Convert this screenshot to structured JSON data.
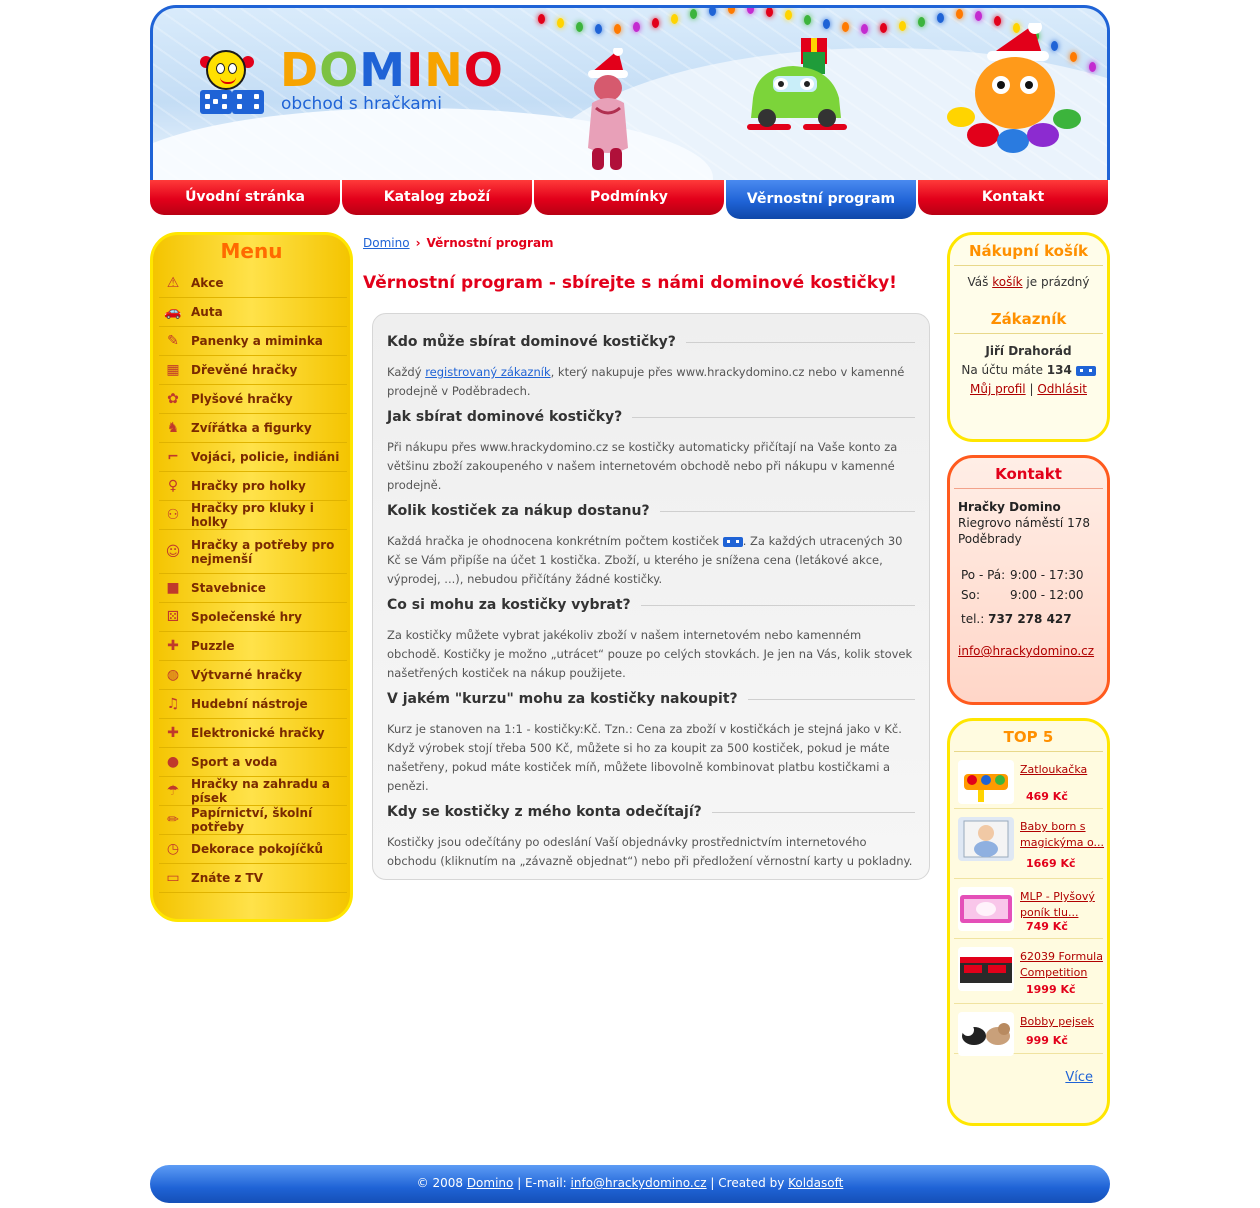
{
  "header": {
    "brand_letters": [
      "D",
      "O",
      "M",
      "I",
      "N",
      "O"
    ],
    "tagline": "obchod s hračkami"
  },
  "nav": {
    "items": [
      "Úvodní stránka",
      "Katalog zboží",
      "Podmínky",
      "Věrnostní program",
      "Kontakt"
    ],
    "active": "Věrnostní program"
  },
  "menu": {
    "title": "Menu",
    "items": [
      {
        "label": "Akce",
        "icon": "warning-icon"
      },
      {
        "label": "Auta",
        "icon": "car-icon"
      },
      {
        "label": "Panenky a miminka",
        "icon": "rattle-icon"
      },
      {
        "label": "Dřevěné hračky",
        "icon": "train-icon"
      },
      {
        "label": "Plyšové hračky",
        "icon": "plush-icon"
      },
      {
        "label": "Zvířátka a figurky",
        "icon": "elephant-icon"
      },
      {
        "label": "Vojáci, policie, indiáni",
        "icon": "gun-icon"
      },
      {
        "label": "Hračky pro holky",
        "icon": "girl-icon"
      },
      {
        "label": "Hračky pro kluky i holky",
        "icon": "kids-icon"
      },
      {
        "label": "Hračky a potřeby pro nejmenší",
        "icon": "baby-icon"
      },
      {
        "label": "Stavebnice",
        "icon": "blocks-icon"
      },
      {
        "label": "Společenské hry",
        "icon": "dice-icon"
      },
      {
        "label": "Puzzle",
        "icon": "puzzle-icon"
      },
      {
        "label": "Výtvarné hračky",
        "icon": "palette-icon"
      },
      {
        "label": "Hudební nástroje",
        "icon": "music-icon"
      },
      {
        "label": "Elektronické hračky",
        "icon": "plus-icon"
      },
      {
        "label": "Sport a voda",
        "icon": "ball-icon"
      },
      {
        "label": "Hračky na zahradu a písek",
        "icon": "bucket-icon"
      },
      {
        "label": "Papírnictví, školní potřeby",
        "icon": "pencil-icon"
      },
      {
        "label": "Dekorace pokojíčků",
        "icon": "clock-icon"
      },
      {
        "label": "Znáte z TV",
        "icon": "tv-icon"
      }
    ]
  },
  "breadcrumb": {
    "home": "Domino",
    "separator": "›",
    "current": "Věrnostní program"
  },
  "page_title": "Věrnostní program - sbírejte s námi dominové kostičky!",
  "sections": [
    {
      "heading": "Kdo může sbírat dominové kostičky?",
      "parts": [
        "Každý ",
        "registrovaný zákazník",
        ", který nakupuje přes www.hrackydomino.cz nebo v kamenné prodejně v Poděbradech."
      ]
    },
    {
      "heading": "Jak sbírat dominové kostičky?",
      "text": "Při nákupu přes www.hrackydomino.cz se kostičky automaticky přičítají na Vaše konto za většinu zboží zakoupeného v našem internetovém obchodě nebo při nákupu v kamenné prodejně."
    },
    {
      "heading": "Kolik kostiček za nákup dostanu?",
      "before_icon": "Každá hračka je ohodnocena konkrétním počtem kostiček ",
      "after_icon": ". Za každých utracených 30 Kč se Vám připíše na účet 1 kostička. Zboží, u kterého je snížena cena (letákové akce, výprodej, ...), nebudou přičítány žádné kostičky."
    },
    {
      "heading": "Co si mohu za kostičky vybrat?",
      "text": "Za kostičky můžete vybrat jakékoliv zboží v našem internetovém nebo kamenném obchodě. Kostičky je možno „utrácet“ pouze po celých stovkách. Je jen na Vás, kolik stovek našetřených kostiček na nákup použijete."
    },
    {
      "heading": "V jakém \"kurzu\" mohu za kostičky nakoupit?",
      "text": "Kurz je stanoven na 1:1 - kostičky:Kč. Tzn.: Cena za zboží v kostičkách je stejná jako v Kč. Když výrobek stojí třeba 500 Kč, můžete si ho za koupit za 500 kostiček, pokud je máte našetřeny, pokud máte kostiček míň, můžete libovolně kombinovat platbu kostičkami a penězi."
    },
    {
      "heading": "Kdy se kostičky z mého konta odečítají?",
      "text": "Kostičky jsou odečítány po odeslání Vaší objednávky prostřednictvím internetového obchodu (kliknutím na „závazně objednat“) nebo při předložení věrnostní karty u pokladny."
    }
  ],
  "cart": {
    "title": "Nákupní košík",
    "text_before": "Váš ",
    "link": "košík",
    "text_after": " je prázdný"
  },
  "customer": {
    "title": "Zákazník",
    "name": "Jiří Drahorád",
    "account_prefix": "Na účtu máte ",
    "points": "134",
    "profile_link": "Můj profil",
    "divider": "|",
    "logout_link": "Odhlásit"
  },
  "contact": {
    "title": "Kontakt",
    "company": "Hračky Domino",
    "street": "Riegrovo náměstí 178",
    "city": "Poděbrady",
    "hours": [
      {
        "days": "Po - Pá:",
        "time": "9:00 - 17:30"
      },
      {
        "days": "So:",
        "time": "9:00 - 12:00"
      }
    ],
    "tel_label": "tel.:",
    "tel": "737 278 427",
    "email": "info@hrackydomino.cz"
  },
  "top5": {
    "title": "TOP 5",
    "items": [
      {
        "name": "Zatloukačka",
        "price": "469 Kč"
      },
      {
        "name": "Baby born s magickýma o...",
        "price": "1669 Kč"
      },
      {
        "name": "MLP - Plyšový poník tlu...",
        "price": "749 Kč"
      },
      {
        "name": "62039 Formula Competition",
        "price": "1999 Kč"
      },
      {
        "name": "Bobby pejsek",
        "price": "999 Kč"
      }
    ],
    "more": "Více"
  },
  "footer": {
    "copyright": "© 2008 ",
    "brand_link": "Domino",
    "email_label": " | E-mail: ",
    "email": "info@hrackydomino.cz",
    "created_label": " | Created by ",
    "author": "Koldasoft"
  },
  "colors": {
    "brand_blue": "#1f63d6",
    "brand_red": "#e2001a",
    "menu_yellow": "#ffe600",
    "contact_orange": "#ff5a1e"
  }
}
